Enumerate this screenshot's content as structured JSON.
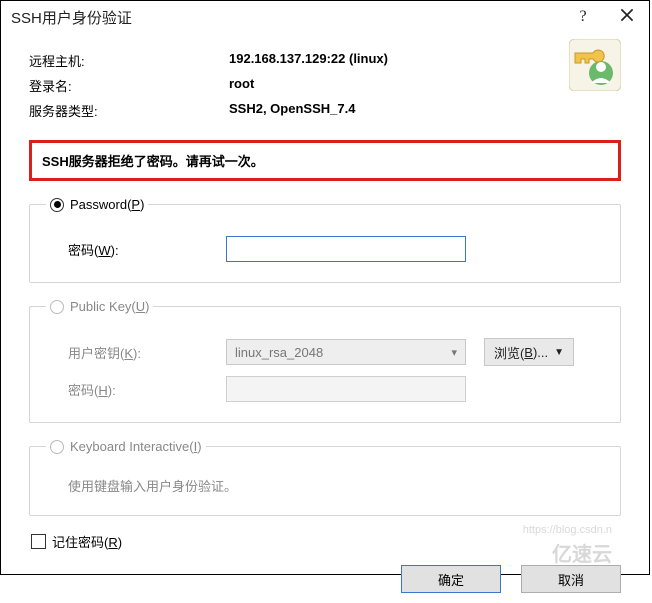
{
  "titlebar": {
    "title": "SSH用户身份验证"
  },
  "info": {
    "remote_host_label": "远程主机:",
    "remote_host_value": "192.168.137.129:22 (linux)",
    "login_label": "登录名:",
    "login_value": "root",
    "server_type_label": "服务器类型:",
    "server_type_value": "SSH2, OpenSSH_7.4"
  },
  "error_message": "SSH服务器拒绝了密码。请再试一次。",
  "auth": {
    "password": {
      "legend_prefix": "Password(",
      "legend_accel": "P",
      "legend_suffix": ")",
      "label_prefix": "密码(",
      "label_accel": "W",
      "label_suffix": "):",
      "value": ""
    },
    "publickey": {
      "legend_prefix": "Public Key(",
      "legend_accel": "U",
      "legend_suffix": ")",
      "userkey_label_prefix": "用户密钥(",
      "userkey_label_accel": "K",
      "userkey_label_suffix": "):",
      "userkey_value": "linux_rsa_2048",
      "browse_prefix": "浏览(",
      "browse_accel": "B",
      "browse_suffix": ")...",
      "passphrase_label_prefix": "密码(",
      "passphrase_label_accel": "H",
      "passphrase_label_suffix": "):"
    },
    "keyboard": {
      "legend_prefix": "Keyboard Interactive(",
      "legend_accel": "I",
      "legend_suffix": ")",
      "hint": "使用键盘输入用户身份验证。"
    }
  },
  "remember": {
    "label_prefix": "记住密码(",
    "label_accel": "R",
    "label_suffix": ")"
  },
  "buttons": {
    "ok": "确定",
    "cancel": "取消"
  },
  "watermark": {
    "line1": "https://blog.csdn.n",
    "line2": "亿速云"
  },
  "icons": {
    "help": "help-icon",
    "close": "close-icon",
    "key_user": "key-user-icon",
    "chevron_down": "chevron-down-icon"
  }
}
